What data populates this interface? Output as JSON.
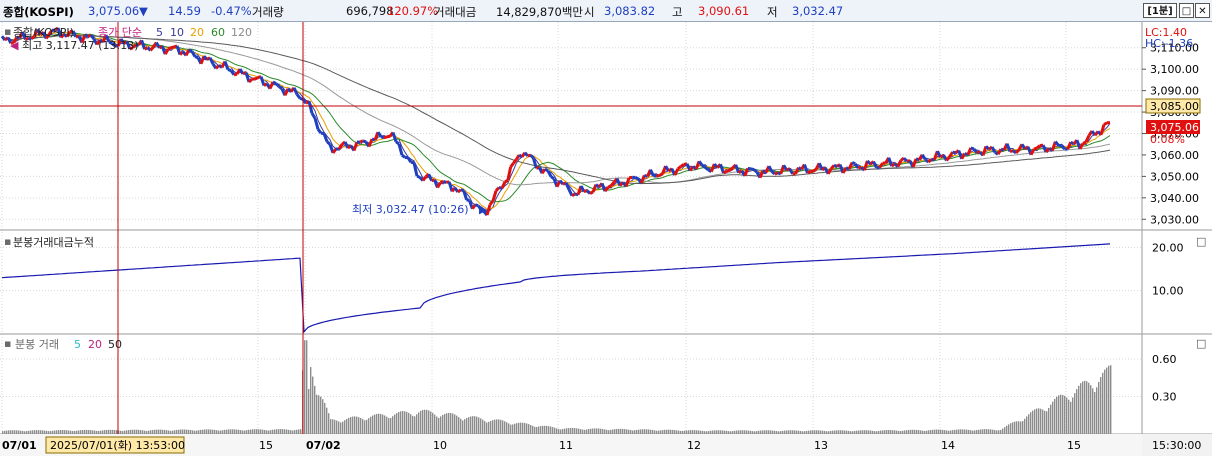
{
  "header": {
    "name": "종합(KOSPI)",
    "price": "3,075.06",
    "direction_arrow": "▼",
    "change": "14.59",
    "change_pct": "-0.47%",
    "volume_label": "거래량",
    "volume": "696,798",
    "volume_ratio": "120.97%",
    "amount_label": "거래대금",
    "amount": "14,829,870백만",
    "open_label": "시",
    "open": "3,083.82",
    "high_label": "고",
    "high": "3,090.61",
    "low_label": "저",
    "low": "3,032.47",
    "period_button": "[1분]"
  },
  "price_panel": {
    "legend_name": "종합(KOSPI)",
    "legend_ma_label": "종가 단순",
    "legend_ma_periods": [
      "5",
      "10",
      "20",
      "60",
      "120"
    ],
    "high_annotation": "최고 3,117.47 (13:13)",
    "low_annotation": "최저 3,032.47 (10:26)",
    "lc_label": "LC:1.40",
    "hc_label": "HC:-1.36",
    "ref_price_tag": "3,085.00",
    "last_price_tag": "3,075.06",
    "last_pct_tag": "0.08%",
    "y_ticks": [
      "3,110.00",
      "3,100.00",
      "3,090.00",
      "3,080.00",
      "3,070.00",
      "3,060.00",
      "3,050.00",
      "3,040.00",
      "3,030.00"
    ],
    "y_tick_values": [
      3110,
      3100,
      3090,
      3080,
      3070,
      3060,
      3050,
      3040,
      3030
    ]
  },
  "amount_panel": {
    "title": "분봉거래대금누적",
    "y_ticks": [
      "20.00",
      "10.00"
    ],
    "y_tick_values": [
      20,
      10
    ]
  },
  "volume_panel": {
    "title": "분봉 거래",
    "ma_periods": [
      "5",
      "20",
      "50"
    ],
    "y_ticks": [
      "0.60",
      "0.30"
    ],
    "y_tick_values": [
      0.6,
      0.3
    ]
  },
  "x_axis": {
    "labels": [
      "07/01",
      "15",
      "07/02",
      "10",
      "11",
      "12",
      "13",
      "14",
      "15"
    ],
    "crosshair_label": "2025/07/01(화) 13:53:00",
    "right_time": "15:30:00"
  },
  "colors": {
    "up": "#e01010",
    "down": "#1f3fbf",
    "ma5": "#3a3a9a",
    "ma10": "#e8a000",
    "ma20": "#2a8a2a",
    "ma60": "#9a9a9a",
    "ma120": "#5a5a5a",
    "bar": "#8c8c8c",
    "crosshair": "#c00000"
  },
  "chart_data": [
    {
      "type": "line",
      "title": "종합(KOSPI) 1분봉",
      "x": [
        "07/01 13:00",
        "07/01 13:13",
        "07/01 13:53",
        "07/01 14:20",
        "07/01 14:50",
        "07/01 15:30",
        "07/02 09:00",
        "07/02 09:15",
        "07/02 09:30",
        "07/02 09:45",
        "07/02 10:00",
        "07/02 10:15",
        "07/02 10:26",
        "07/02 10:40",
        "07/02 10:50",
        "07/02 11:00",
        "07/02 11:20",
        "07/02 11:40",
        "07/02 12:00",
        "07/02 12:30",
        "07/02 13:00",
        "07/02 13:30",
        "07/02 14:00",
        "07/02 14:30",
        "07/02 15:00",
        "07/02 15:20"
      ],
      "series": [
        {
          "name": "종가",
          "values": [
            3113,
            3117.47,
            3112,
            3109,
            3098,
            3088,
            3085,
            3063,
            3065,
            3070,
            3050,
            3045,
            3032.47,
            3048,
            3062,
            3052,
            3042,
            3047,
            3055,
            3052,
            3054,
            3057,
            3062,
            3063,
            3065,
            3075.06
          ]
        }
      ],
      "ylim": [
        3025,
        3122
      ],
      "xlabel": "",
      "ylabel": "",
      "grid": true
    },
    {
      "type": "line",
      "title": "분봉거래대금누적",
      "x": [
        "07/01 13:00",
        "07/01 15:30",
        "07/02 09:00",
        "07/02 10:00",
        "07/02 11:00",
        "07/02 12:00",
        "07/02 13:00",
        "07/02 14:00",
        "07/02 15:20"
      ],
      "values": [
        13,
        17.5,
        0.5,
        6,
        12,
        14.5,
        16.5,
        18.5,
        20.8
      ],
      "ylim": [
        0,
        24
      ],
      "grid": true
    },
    {
      "type": "bar",
      "title": "분봉 거래",
      "categories": [
        "07/01 13:00",
        "07/01 15:30",
        "07/02 09:00",
        "07/02 09:30",
        "07/02 10:00",
        "07/02 11:00",
        "07/02 12:00",
        "07/02 13:00",
        "07/02 14:00",
        "07/02 15:20"
      ],
      "values": [
        0.03,
        0.04,
        0.75,
        0.12,
        0.2,
        0.05,
        0.03,
        0.03,
        0.04,
        0.55
      ],
      "ylim": [
        0,
        0.8
      ],
      "grid": true
    }
  ]
}
